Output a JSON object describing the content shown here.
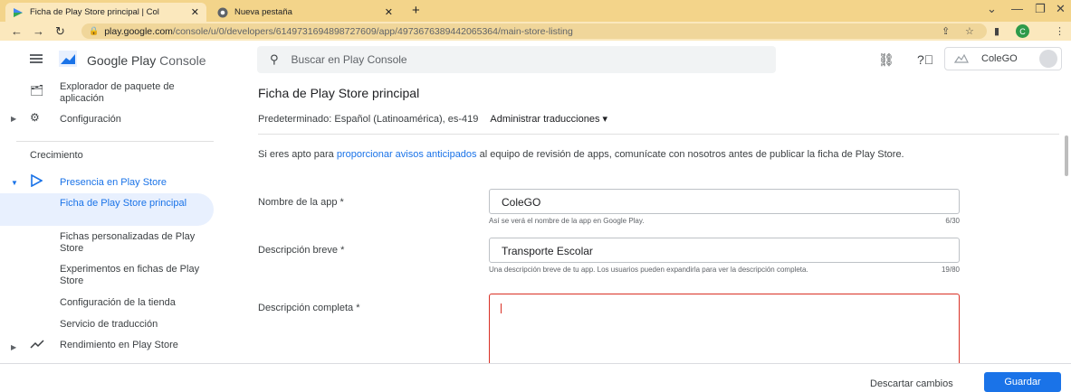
{
  "browser": {
    "tabs": [
      {
        "title": "Ficha de Play Store principal | Col",
        "active": true
      },
      {
        "title": "Nueva pestaña",
        "active": false
      }
    ],
    "new_tab": "+",
    "url_host": "play.google.com",
    "url_path": "/console/u/0/developers/6149731694898727609/app/4973676389442065364/main-store-listing",
    "profile_initial": "C",
    "colors": {
      "tab_strip": "#f3d48a",
      "address_bar": "#fbe8bd",
      "accent": "#1a73e8",
      "error": "#d93025",
      "active_nav": "#e8f0fe"
    }
  },
  "header": {
    "brand_word1": "Google Play",
    "brand_word2": "Console",
    "search_placeholder": "Buscar en Play Console",
    "account_name": "ColeGO"
  },
  "sidebar": {
    "explorer": "Explorador de paquete de aplicación",
    "config": "Configuración",
    "section_growth": "Crecimiento",
    "presence": "Presencia en Play Store",
    "sub_items": [
      "Ficha de Play Store principal",
      "Fichas personalizadas de Play Store",
      "Experimentos en fichas de Play Store",
      "Configuración de la tienda",
      "Servicio de traducción"
    ],
    "performance": "Rendimiento en Play Store"
  },
  "main": {
    "title": "Ficha de Play Store principal",
    "language": "Predeterminado: Español (Latinoamérica), es-419",
    "manage_translations": "Administrar traducciones",
    "notice_pre": "Si eres apto para ",
    "notice_link": "proporcionar avisos anticipados",
    "notice_post": " al equipo de revisión de apps, comunícate con nosotros antes de publicar la ficha de Play Store.",
    "fields": {
      "app_name_label": "Nombre de la app",
      "app_name_value": "ColeGO",
      "app_name_helper": "Así se verá el nombre de la app en Google Play.",
      "app_name_counter": "6/30",
      "short_desc_label": "Descripción breve",
      "short_desc_value": "Transporte Escolar",
      "short_desc_helper": "Una descripción breve de tu app. Los usuarios pueden expandirla para ver la descripción completa.",
      "short_desc_counter": "19/80",
      "full_desc_label": "Descripción completa",
      "full_desc_value": ""
    },
    "required_mark": "*"
  },
  "footer": {
    "discard": "Descartar cambios",
    "save": "Guardar"
  }
}
